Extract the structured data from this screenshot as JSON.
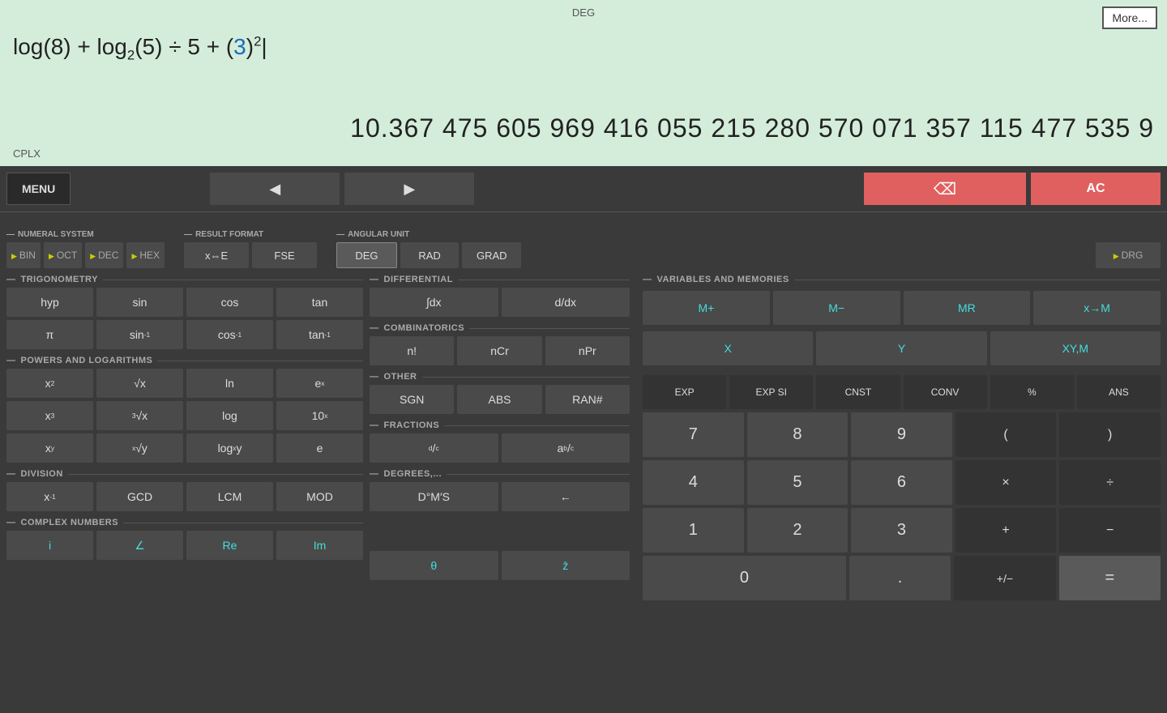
{
  "display": {
    "deg_label": "DEG",
    "cplx_label": "CPLX",
    "more_btn": "More...",
    "expression_html": "log(8) + log<sub>2</sub>(5) ÷ 5 + (<span class='blue-num'>3</span>)<sup>2</sup>|",
    "result": "10.367 475 605 969 416 055 215 280 570 071 357 115 477 535 9"
  },
  "topbar": {
    "menu": "MENU",
    "back_arrow": "◀",
    "fwd_arrow": "▶",
    "backspace": "⌫",
    "ac": "AC"
  },
  "numeral": {
    "label": "NUMERAL SYSTEM",
    "bin": "▶BIN",
    "oct": "▶OCT",
    "dec": "▶DEC",
    "hex": "▶HEX"
  },
  "result_format": {
    "label": "RESULT FORMAT",
    "xe": "x⇔E",
    "fse": "FSE"
  },
  "angular": {
    "label": "ANGULAR UNIT",
    "deg": "DEG",
    "rad": "RAD",
    "grad": "GRAD",
    "drg": "▶DRG"
  },
  "trig": {
    "label": "TRIGONOMETRY",
    "hyp": "hyp",
    "sin": "sin",
    "cos": "cos",
    "tan": "tan",
    "pi": "π",
    "sin_inv": "sin⁻¹",
    "cos_inv": "cos⁻¹",
    "tan_inv": "tan⁻¹"
  },
  "differential": {
    "label": "DIFFERENTIAL",
    "integral": "∫dx",
    "derivative": "d/dx"
  },
  "vars": {
    "label": "VARIABLES AND MEMORIES",
    "mplus": "M+",
    "mminus": "M−",
    "mr": "MR",
    "xm": "x→M",
    "x": "X",
    "y": "Y",
    "xym": "XY,M"
  },
  "combinatorics": {
    "label": "COMBINATORICS",
    "nfact": "n!",
    "ncr": "nCr",
    "npr": "nPr"
  },
  "powers": {
    "label": "POWERS AND LOGARITHMS",
    "x2": "x²",
    "sqrt": "√x",
    "ln": "ln",
    "ex": "eˣ",
    "x3": "x³",
    "cbrt": "³√x",
    "log": "log",
    "ten_x": "10ˣ",
    "xy": "xʸ",
    "xrt": "ˣ√y",
    "logxy": "logₓy",
    "e": "e"
  },
  "other": {
    "label": "OTHER",
    "sgn": "SGN",
    "abs": "ABS",
    "ran": "RAN#"
  },
  "fractions": {
    "label": "FRACTIONS",
    "dc": "d/c",
    "abc": "a b/c"
  },
  "division": {
    "label": "DIVISION",
    "xinv": "x⁻¹",
    "gcd": "GCD",
    "lcm": "LCM",
    "mod": "MOD"
  },
  "degrees": {
    "label": "DEGREES,...",
    "dms": "D°M′S",
    "arrow": "←"
  },
  "complex": {
    "label": "COMPLEX NUMBERS",
    "i": "i",
    "angle": "∠",
    "re": "Re",
    "im": "Im",
    "theta": "θ",
    "conj": "z̄"
  },
  "numpad": {
    "top_row": [
      "EXP",
      "EXP SI",
      "CNST",
      "CONV",
      "%",
      "ANS"
    ],
    "rows": [
      [
        "7",
        "8",
        "9",
        "(",
        ")"
      ],
      [
        "4",
        "5",
        "6",
        "×",
        "÷"
      ],
      [
        "1",
        "2",
        "3",
        "+",
        "−"
      ],
      [
        "0",
        ".",
        "+/−",
        "="
      ]
    ]
  }
}
